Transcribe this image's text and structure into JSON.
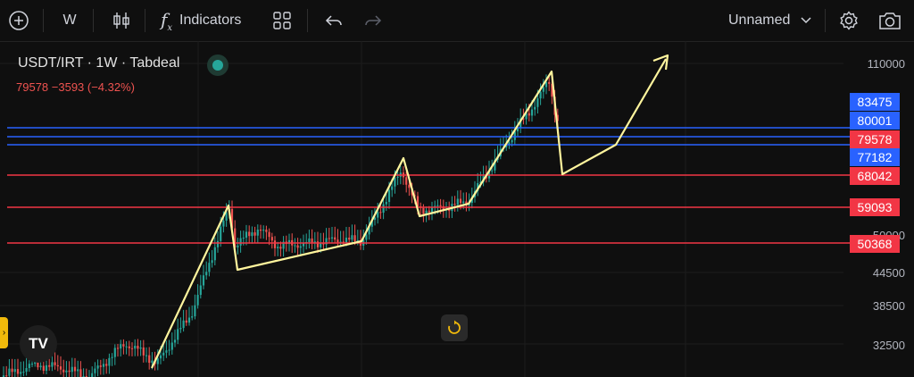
{
  "toolbar": {
    "interval": "W",
    "indicators_label": "Indicators",
    "layout_name": "Unnamed",
    "icons": [
      "add-symbol-icon",
      "candles-icon",
      "fx-icon",
      "templates-icon",
      "undo-icon",
      "redo-icon",
      "chevron-down-icon",
      "settings-icon",
      "camera-icon"
    ]
  },
  "symbol": {
    "title": "USDT/IRT · 1W · Tabdeal",
    "quote": "79578  −3593 (−4.32%)"
  },
  "price_axis": [
    "110000",
    "50000",
    "44500",
    "38500",
    "32500"
  ],
  "badges": [
    {
      "label": "83475",
      "color": "#2962ff"
    },
    {
      "label": "80001",
      "color": "#2962ff"
    },
    {
      "label": "79578",
      "color": "#f23645"
    },
    {
      "label": "77182",
      "color": "#2962ff"
    },
    {
      "label": "68042",
      "color": "#f23645"
    },
    {
      "label": "59093",
      "color": "#f23645"
    },
    {
      "label": "50368",
      "color": "#f23645"
    }
  ],
  "colors": {
    "up": "#26a69a",
    "down": "#ef5350",
    "blue_line": "#2962ff",
    "red_line": "#f23645",
    "drawing": "#fff59d",
    "handle": "#f0b90b"
  },
  "logo_text": "TV"
}
